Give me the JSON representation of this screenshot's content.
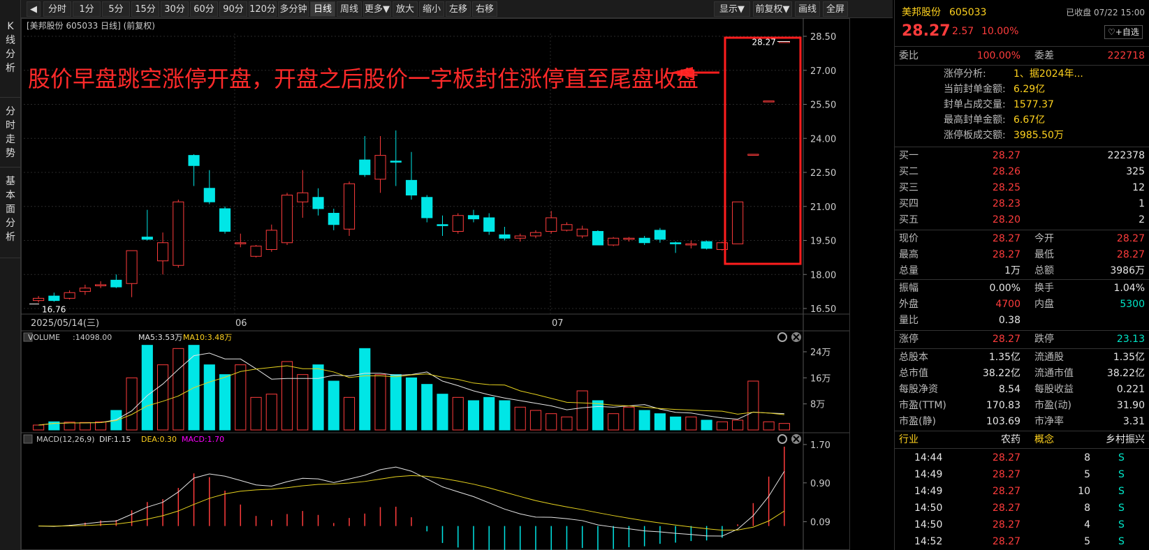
{
  "side_tabs": [
    "K线分析",
    "分时走势",
    "基本面分析"
  ],
  "toolbar": {
    "back": "◀",
    "items": [
      "分时",
      "1分",
      "5分",
      "15分",
      "30分",
      "60分",
      "90分",
      "120分",
      "多分钟",
      "日线",
      "周线",
      "更多▼",
      "放大",
      "缩小",
      "左移",
      "右移"
    ],
    "active": "日线",
    "right_items": [
      "显示▼",
      "前复权▼",
      "画线",
      "全屏"
    ]
  },
  "kline": {
    "header": "[美邦股份 605033 日线] (前复权)",
    "y_ticks": [
      "28.50",
      "27.00",
      "25.50",
      "24.00",
      "22.50",
      "21.00",
      "19.50",
      "18.00",
      "16.50"
    ],
    "x_date": "2025/05/14(三)",
    "x_months": [
      "06",
      "07"
    ],
    "high_label": "28.27",
    "low_label": "16.76",
    "annotation": "股价早盘跳空涨停开盘，开盘之后股价一字板封住涨停直至尾盘收盘"
  },
  "volume": {
    "title": "VOLUME",
    "value": ":14098.00",
    "ma5": "MA5:3.53万",
    "ma10": "MA10:3.48万",
    "y_ticks": [
      "24万",
      "16万",
      "8万"
    ]
  },
  "macd": {
    "title": "MACD(12,26,9)",
    "dif": "DIF:1.15",
    "dea": "DEA:0.30",
    "macd": "MACD:1.70",
    "y_ticks": [
      "1.70",
      "0.90",
      "0.09"
    ]
  },
  "colors": {
    "up": "#ff3c3c",
    "down": "#00e6e6",
    "ma5": "#e6e6e6",
    "ma10": "#e6d21e",
    "macd": "#ff00ff"
  },
  "chart_data": {
    "type": "candlestick",
    "ylim": [
      16.5,
      28.5
    ],
    "candles": [
      {
        "o": 16.85,
        "c": 16.95,
        "h": 17.05,
        "l": 16.76
      },
      {
        "o": 17.05,
        "c": 16.85,
        "h": 17.2,
        "l": 16.8
      },
      {
        "o": 16.95,
        "c": 17.2,
        "h": 17.3,
        "l": 16.9
      },
      {
        "o": 17.25,
        "c": 17.4,
        "h": 17.55,
        "l": 17.1
      },
      {
        "o": 17.5,
        "c": 17.55,
        "h": 17.7,
        "l": 17.4
      },
      {
        "o": 17.75,
        "c": 17.45,
        "h": 18.0,
        "l": 17.4
      },
      {
        "o": 17.6,
        "c": 19.05,
        "h": 19.05,
        "l": 17.0
      },
      {
        "o": 19.65,
        "c": 19.55,
        "h": 20.85,
        "l": 19.5
      },
      {
        "o": 18.6,
        "c": 19.4,
        "h": 19.85,
        "l": 18.0
      },
      {
        "o": 18.4,
        "c": 21.2,
        "h": 21.3,
        "l": 18.3
      },
      {
        "o": 23.25,
        "c": 22.8,
        "h": 23.3,
        "l": 21.9
      },
      {
        "o": 21.8,
        "c": 21.2,
        "h": 22.6,
        "l": 21.1
      },
      {
        "o": 20.9,
        "c": 19.9,
        "h": 21.0,
        "l": 19.8
      },
      {
        "o": 19.4,
        "c": 19.4,
        "h": 19.8,
        "l": 19.2
      },
      {
        "o": 18.8,
        "c": 19.25,
        "h": 19.3,
        "l": 18.75
      },
      {
        "o": 19.1,
        "c": 19.95,
        "h": 20.2,
        "l": 19.0
      },
      {
        "o": 19.4,
        "c": 21.5,
        "h": 21.6,
        "l": 19.3
      },
      {
        "o": 21.2,
        "c": 21.6,
        "h": 22.6,
        "l": 20.5
      },
      {
        "o": 21.4,
        "c": 20.9,
        "h": 21.8,
        "l": 20.6
      },
      {
        "o": 20.7,
        "c": 20.2,
        "h": 20.9,
        "l": 19.95
      },
      {
        "o": 20.0,
        "c": 22.0,
        "h": 22.1,
        "l": 19.7
      },
      {
        "o": 23.05,
        "c": 22.4,
        "h": 24.1,
        "l": 22.3
      },
      {
        "o": 22.2,
        "c": 23.25,
        "h": 24.1,
        "l": 21.6
      },
      {
        "o": 23.0,
        "c": 22.95,
        "h": 24.35,
        "l": 21.9
      },
      {
        "o": 22.15,
        "c": 21.5,
        "h": 23.4,
        "l": 21.3
      },
      {
        "o": 21.4,
        "c": 20.5,
        "h": 21.5,
        "l": 20.3
      },
      {
        "o": 20.2,
        "c": 20.15,
        "h": 20.6,
        "l": 19.7
      },
      {
        "o": 19.9,
        "c": 20.6,
        "h": 20.7,
        "l": 19.8
      },
      {
        "o": 20.6,
        "c": 20.45,
        "h": 20.85,
        "l": 20.3
      },
      {
        "o": 20.5,
        "c": 19.9,
        "h": 20.7,
        "l": 19.75
      },
      {
        "o": 19.75,
        "c": 19.6,
        "h": 20.1,
        "l": 19.5
      },
      {
        "o": 19.6,
        "c": 19.7,
        "h": 19.8,
        "l": 19.45
      },
      {
        "o": 19.7,
        "c": 19.85,
        "h": 19.95,
        "l": 19.6
      },
      {
        "o": 19.9,
        "c": 20.5,
        "h": 20.8,
        "l": 19.8
      },
      {
        "o": 19.95,
        "c": 20.2,
        "h": 20.3,
        "l": 19.9
      },
      {
        "o": 19.7,
        "c": 20.0,
        "h": 20.15,
        "l": 19.6
      },
      {
        "o": 19.9,
        "c": 19.3,
        "h": 19.95,
        "l": 19.3
      },
      {
        "o": 19.3,
        "c": 19.6,
        "h": 19.65,
        "l": 19.25
      },
      {
        "o": 19.55,
        "c": 19.6,
        "h": 19.65,
        "l": 19.45
      },
      {
        "o": 19.6,
        "c": 19.4,
        "h": 19.7,
        "l": 19.3
      },
      {
        "o": 19.95,
        "c": 19.55,
        "h": 20.05,
        "l": 19.4
      },
      {
        "o": 19.4,
        "c": 19.35,
        "h": 19.45,
        "l": 18.95
      },
      {
        "o": 19.3,
        "c": 19.35,
        "h": 19.5,
        "l": 19.15
      },
      {
        "o": 19.45,
        "c": 19.15,
        "h": 19.5,
        "l": 19.1
      },
      {
        "o": 19.1,
        "c": 19.4,
        "h": 19.45,
        "l": 19.05
      },
      {
        "o": 19.35,
        "c": 21.2,
        "h": 21.2,
        "l": 19.35
      },
      {
        "o": 23.3,
        "c": 23.3,
        "h": 23.3,
        "l": 23.3
      },
      {
        "o": 25.65,
        "c": 25.65,
        "h": 25.65,
        "l": 25.65
      },
      {
        "o": 28.27,
        "c": 28.27,
        "h": 28.27,
        "l": 28.27
      }
    ],
    "volume_ylim": [
      0,
      24
    ],
    "volumes": [
      1.5,
      2.5,
      2.4,
      2.3,
      2.5,
      6,
      16,
      26,
      20,
      25,
      27,
      20,
      17,
      20,
      10,
      11,
      21,
      17,
      20,
      15,
      10,
      25,
      17,
      17,
      16,
      14,
      11,
      10,
      9,
      10,
      9,
      7,
      6,
      5,
      4,
      12,
      9,
      5,
      7,
      6,
      5,
      4,
      4,
      3,
      2.5,
      3,
      15,
      2.5,
      2
    ],
    "macd_ylim": [
      -0.5,
      1.8
    ]
  },
  "panel": {
    "name": "美邦股份",
    "code": "605033",
    "status": "已收盘 07/22 15:00",
    "price": "28.27",
    "change": "2.57",
    "pct": "10.00%",
    "fav": "♡+自选",
    "weibi_label": "委比",
    "weibi": "100.00%",
    "weicha_label": "委差",
    "weicha": "222718",
    "limit_rows": [
      {
        "label": "涨停分析:",
        "value": "1、据2024年..."
      },
      {
        "label": "当前封单金额:",
        "value": "6.29亿"
      },
      {
        "label": "封单占成交量:",
        "value": "1577.37"
      },
      {
        "label": "最高封单金额:",
        "value": "6.67亿"
      },
      {
        "label": "涨停板成交额:",
        "value": "3985.50万"
      }
    ],
    "bids": [
      {
        "label": "买一",
        "price": "28.27",
        "vol": "222378"
      },
      {
        "label": "买二",
        "price": "28.26",
        "vol": "325"
      },
      {
        "label": "买三",
        "price": "28.25",
        "vol": "12"
      },
      {
        "label": "买四",
        "price": "28.23",
        "vol": "1"
      },
      {
        "label": "买五",
        "price": "28.20",
        "vol": "2"
      }
    ],
    "stats1": [
      {
        "l1": "现价",
        "v1": "28.27",
        "c1": "red",
        "l2": "今开",
        "v2": "28.27",
        "c2": "red"
      },
      {
        "l1": "最高",
        "v1": "28.27",
        "c1": "red",
        "l2": "最低",
        "v2": "28.27",
        "c2": "red"
      },
      {
        "l1": "总量",
        "v1": "1万",
        "c1": "white",
        "l2": "总额",
        "v2": "3986万",
        "c2": "white"
      }
    ],
    "stats2": [
      {
        "l1": "振幅",
        "v1": "0.00%",
        "c1": "white",
        "l2": "换手",
        "v2": "1.04%",
        "c2": "white"
      },
      {
        "l1": "外盘",
        "v1": "4700",
        "c1": "red",
        "l2": "内盘",
        "v2": "5300",
        "c2": "green"
      },
      {
        "l1": "量比",
        "v1": "0.38",
        "c1": "white",
        "l2": "",
        "v2": "",
        "c2": "white"
      }
    ],
    "limits": {
      "l1": "涨停",
      "v1": "28.27",
      "l2": "跌停",
      "v2": "23.13"
    },
    "stats3": [
      {
        "l1": "总股本",
        "v1": "1.35亿",
        "l2": "流通股",
        "v2": "1.35亿"
      },
      {
        "l1": "总市值",
        "v1": "38.22亿",
        "l2": "流通市值",
        "v2": "38.22亿"
      },
      {
        "l1": "每股净资",
        "v1": "8.54",
        "l2": "每股收益",
        "v2": "0.221"
      },
      {
        "l1": "市盈(TTM)",
        "v1": "170.83",
        "l2": "市盈(动)",
        "v2": "31.90"
      },
      {
        "l1": "市盈(静)",
        "v1": "103.69",
        "l2": "市净率",
        "v2": "3.31"
      }
    ],
    "industry": {
      "l1": "行业",
      "v1": "农药",
      "l2": "概念",
      "v2": "乡村振兴"
    },
    "ticks": [
      {
        "time": "14:44",
        "price": "28.27",
        "vol": "8",
        "side": "S"
      },
      {
        "time": "14:49",
        "price": "28.27",
        "vol": "5",
        "side": "S"
      },
      {
        "time": "14:49",
        "price": "28.27",
        "vol": "10",
        "side": "S"
      },
      {
        "time": "14:50",
        "price": "28.27",
        "vol": "8",
        "side": "S"
      },
      {
        "time": "14:50",
        "price": "28.27",
        "vol": "4",
        "side": "S"
      },
      {
        "time": "14:52",
        "price": "28.27",
        "vol": "5",
        "side": "S"
      }
    ]
  }
}
